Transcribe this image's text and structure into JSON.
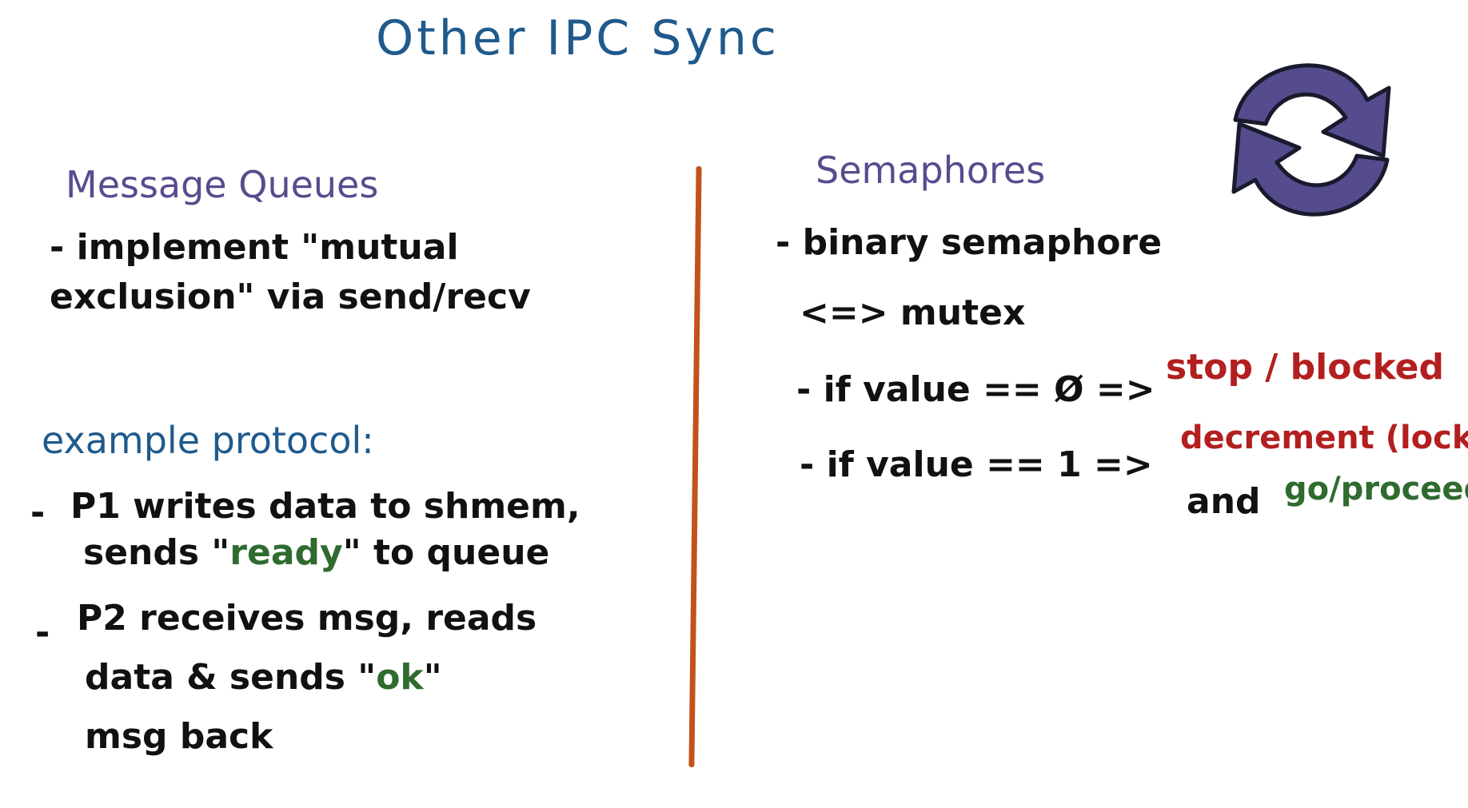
{
  "title": "Other IPC Sync",
  "message_queues": {
    "heading": "Message Queues",
    "line1": "- implement \"mutual",
    "line2": "exclusion\" via send/recv"
  },
  "example_protocol": {
    "heading": "example protocol:",
    "item1": {
      "bullet": "-",
      "line1": "P1 writes data to shmem,",
      "line2_pre": "sends \"",
      "line2_word": "ready",
      "line2_post": "\" to queue"
    },
    "item2": {
      "bullet": "-",
      "line1": "P2 receives msg, reads",
      "line2_pre": "data & sends \"",
      "line2_word": "ok",
      "line2_post": "\"",
      "line3": "msg back"
    }
  },
  "semaphores": {
    "heading": "Semaphores",
    "line1": "- binary semaphore",
    "line2": "<=> mutex",
    "cond1_pre": "- if value == Ø =>",
    "cond1_result": "stop / blocked",
    "cond2_pre": "- if value == 1 =>",
    "cond2_result": "decrement (lock)",
    "cond2_and": "and",
    "cond2_go": "go/proceed"
  },
  "colors": {
    "title": "#1f5a8c",
    "heading_purple": "#5a4a8e",
    "divider": "#c2521c",
    "red": "#b31f1f",
    "green": "#2f6b2f",
    "icon": "#544c8c"
  },
  "icon": "sync-arrows-icon"
}
